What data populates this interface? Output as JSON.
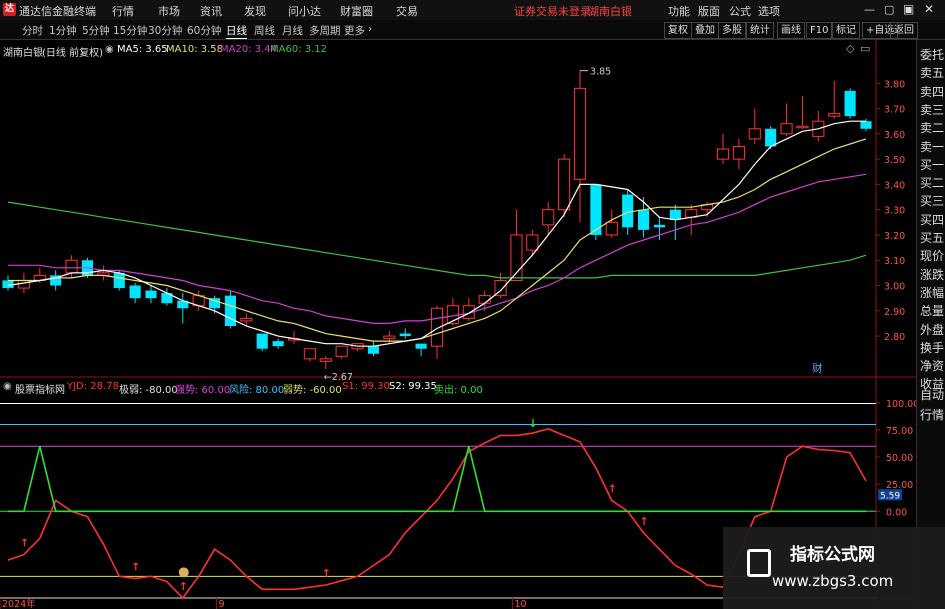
{
  "app": {
    "title": "通达信金融终端"
  },
  "menu": [
    "行情",
    "市场",
    "资讯",
    "发现",
    "问小达",
    "财富圈",
    "交易"
  ],
  "menu_notice": "证券交易未登录",
  "menu_stock": "湖南白银",
  "menu_right": [
    "功能",
    "版面",
    "公式",
    "选项"
  ],
  "tabs": [
    "分时",
    "1分钟",
    "5分钟",
    "15分钟",
    "30分钟",
    "60分钟",
    "日线",
    "周线",
    "月线",
    "多周期",
    "更多"
  ],
  "tab_active": "日线",
  "right_buttons": [
    "复权",
    "叠加",
    "多股",
    "统计",
    "画线",
    "F10",
    "标记",
    "+自选",
    "返回"
  ],
  "info": {
    "stock_name": "湖南白银",
    "mode": "(日线 前复权)",
    "ma5": "MA5: 3.65",
    "ma10": "MA10: 3.58",
    "ma20": "MA20: 3.44",
    "ma60": "MA60: 3.12"
  },
  "side_panel": [
    "委托",
    "卖五",
    "卖四",
    "卖三",
    "卖二",
    "卖一",
    "买一",
    "买二",
    "买三",
    "买四",
    "买五",
    "现价",
    "涨跌",
    "涨幅",
    "总量",
    "外盘",
    "换手",
    "净资",
    "收益",
    "自动",
    "行情"
  ],
  "indicator_header": {
    "name": "股票指标网",
    "items": [
      {
        "text": "YJD: 28.78",
        "color": "#ff3030"
      },
      {
        "text": "极弱: -80.00",
        "color": "#e0e0e0"
      },
      {
        "text": "强势: 60.00",
        "color": "#e040e0"
      },
      {
        "text": "风险: 80.00",
        "color": "#40c0ff"
      },
      {
        "text": "弱势: -60.00",
        "color": "#e0e060"
      },
      {
        "text": "S1: 99.30",
        "color": "#ff3030"
      },
      {
        "text": "S2: 99.35",
        "color": "#ffffff"
      },
      {
        "text": "卖出: 0.00",
        "color": "#30e030"
      }
    ]
  },
  "colors": {
    "up": "#ff3232",
    "down": "#00e5ff",
    "ma5": "#ffffff",
    "ma10": "#e8e070",
    "ma20": "#d040d0",
    "ma60": "#40c040"
  },
  "watermark": {
    "title": "指标公式网",
    "url": "www.zbgs3.com"
  },
  "chart_data": [
    {
      "type": "candlestick",
      "ylim": [
        2.65,
        3.9
      ],
      "yticks": [
        2.8,
        2.9,
        3.0,
        3.1,
        3.2,
        3.3,
        3.4,
        3.5,
        3.6,
        3.7,
        3.8
      ],
      "ma_legend": [
        "MA5",
        "MA10",
        "MA20",
        "MA60"
      ],
      "high_label": "3.85",
      "low_label": "2.67",
      "fin_marker": "财",
      "candles": [
        [
          3.02,
          2.99,
          3.04,
          2.98
        ],
        [
          2.99,
          3.02,
          3.05,
          2.97
        ],
        [
          3.02,
          3.04,
          3.07,
          3.01
        ],
        [
          3.04,
          3.0,
          3.06,
          2.98
        ],
        [
          3.05,
          3.1,
          3.12,
          3.03
        ],
        [
          3.1,
          3.04,
          3.11,
          3.03
        ],
        [
          3.04,
          3.05,
          3.08,
          3.02
        ],
        [
          3.05,
          2.99,
          3.06,
          2.98
        ],
        [
          3.0,
          2.95,
          3.01,
          2.93
        ],
        [
          2.98,
          2.95,
          3.0,
          2.93
        ],
        [
          2.97,
          2.93,
          2.99,
          2.92
        ],
        [
          2.94,
          2.91,
          2.97,
          2.85
        ],
        [
          2.92,
          2.96,
          2.98,
          2.9
        ],
        [
          2.95,
          2.91,
          2.96,
          2.89
        ],
        [
          2.96,
          2.84,
          2.98,
          2.83
        ],
        [
          2.86,
          2.87,
          2.89,
          2.84
        ],
        [
          2.81,
          2.75,
          2.81,
          2.74
        ],
        [
          2.78,
          2.76,
          2.79,
          2.75
        ],
        [
          2.79,
          2.79,
          2.82,
          2.77
        ],
        [
          2.71,
          2.75,
          2.75,
          2.7
        ],
        [
          2.7,
          2.71,
          2.72,
          2.67
        ],
        [
          2.72,
          2.76,
          2.76,
          2.71
        ],
        [
          2.75,
          2.77,
          2.77,
          2.74
        ],
        [
          2.76,
          2.73,
          2.78,
          2.72
        ],
        [
          2.79,
          2.8,
          2.82,
          2.77
        ],
        [
          2.81,
          2.8,
          2.83,
          2.79
        ],
        [
          2.77,
          2.75,
          2.77,
          2.72
        ],
        [
          2.76,
          2.91,
          2.92,
          2.71
        ],
        [
          2.85,
          2.92,
          2.95,
          2.84
        ],
        [
          2.87,
          2.92,
          2.95,
          2.86
        ],
        [
          2.93,
          2.96,
          2.98,
          2.9
        ],
        [
          2.96,
          3.02,
          3.05,
          2.95
        ],
        [
          3.02,
          3.2,
          3.3,
          3.02
        ],
        [
          3.14,
          3.2,
          3.22,
          3.12
        ],
        [
          3.24,
          3.3,
          3.33,
          3.2
        ],
        [
          3.3,
          3.5,
          3.52,
          3.27
        ],
        [
          3.42,
          3.78,
          3.85,
          3.25
        ],
        [
          3.4,
          3.2,
          3.4,
          3.18
        ],
        [
          3.2,
          3.25,
          3.3,
          3.19
        ],
        [
          3.36,
          3.23,
          3.38,
          3.2
        ],
        [
          3.3,
          3.22,
          3.35,
          3.19
        ],
        [
          3.24,
          3.23,
          3.27,
          3.18
        ],
        [
          3.3,
          3.26,
          3.32,
          3.18
        ],
        [
          3.27,
          3.3,
          3.32,
          3.2
        ],
        [
          3.3,
          3.32,
          3.33,
          3.27
        ],
        [
          3.5,
          3.54,
          3.6,
          3.48
        ],
        [
          3.5,
          3.55,
          3.58,
          3.46
        ],
        [
          3.58,
          3.62,
          3.7,
          3.56
        ],
        [
          3.62,
          3.55,
          3.63,
          3.54
        ],
        [
          3.6,
          3.64,
          3.72,
          3.59
        ],
        [
          3.63,
          3.63,
          3.75,
          3.62
        ],
        [
          3.59,
          3.65,
          3.69,
          3.57
        ],
        [
          3.67,
          3.68,
          3.81,
          3.66
        ],
        [
          3.77,
          3.67,
          3.78,
          3.66
        ],
        [
          3.65,
          3.62,
          3.66,
          3.61
        ]
      ],
      "ma5": [
        3.0,
        3.01,
        3.02,
        3.03,
        3.05,
        3.05,
        3.06,
        3.05,
        3.03,
        3.0,
        2.97,
        2.94,
        2.92,
        2.9,
        2.87,
        2.84,
        2.82,
        2.8,
        2.79,
        2.78,
        2.77,
        2.77,
        2.76,
        2.76,
        2.77,
        2.78,
        2.79,
        2.83,
        2.86,
        2.89,
        2.93,
        2.98,
        3.05,
        3.12,
        3.2,
        3.28,
        3.4,
        3.4,
        3.39,
        3.38,
        3.33,
        3.27,
        3.26,
        3.27,
        3.28,
        3.34,
        3.4,
        3.48,
        3.55,
        3.58,
        3.61,
        3.62,
        3.64,
        3.65,
        3.65
      ],
      "ma10": [
        3.02,
        3.02,
        3.02,
        3.03,
        3.03,
        3.04,
        3.04,
        3.03,
        3.02,
        3.01,
        3.0,
        2.98,
        2.96,
        2.94,
        2.92,
        2.9,
        2.88,
        2.86,
        2.85,
        2.83,
        2.81,
        2.8,
        2.79,
        2.78,
        2.78,
        2.78,
        2.79,
        2.81,
        2.83,
        2.85,
        2.87,
        2.9,
        2.95,
        3.0,
        3.05,
        3.1,
        3.18,
        3.22,
        3.26,
        3.29,
        3.3,
        3.31,
        3.31,
        3.31,
        3.32,
        3.33,
        3.35,
        3.38,
        3.42,
        3.45,
        3.48,
        3.51,
        3.54,
        3.56,
        3.58
      ],
      "ma20": [
        3.08,
        3.08,
        3.08,
        3.07,
        3.07,
        3.07,
        3.06,
        3.06,
        3.05,
        3.04,
        3.03,
        3.02,
        3.0,
        2.99,
        2.98,
        2.96,
        2.94,
        2.93,
        2.91,
        2.9,
        2.88,
        2.87,
        2.86,
        2.85,
        2.85,
        2.86,
        2.86,
        2.87,
        2.88,
        2.89,
        2.91,
        2.93,
        2.95,
        2.98,
        3.0,
        3.03,
        3.07,
        3.1,
        3.13,
        3.16,
        3.18,
        3.2,
        3.22,
        3.24,
        3.25,
        3.27,
        3.29,
        3.32,
        3.35,
        3.37,
        3.39,
        3.41,
        3.42,
        3.43,
        3.44
      ],
      "ma60": [
        3.33,
        3.32,
        3.31,
        3.3,
        3.29,
        3.28,
        3.27,
        3.26,
        3.25,
        3.24,
        3.23,
        3.22,
        3.21,
        3.2,
        3.19,
        3.18,
        3.17,
        3.16,
        3.15,
        3.14,
        3.13,
        3.12,
        3.11,
        3.1,
        3.09,
        3.08,
        3.07,
        3.06,
        3.05,
        3.04,
        3.04,
        3.03,
        3.03,
        3.03,
        3.03,
        3.03,
        3.03,
        3.03,
        3.04,
        3.04,
        3.04,
        3.04,
        3.04,
        3.04,
        3.04,
        3.04,
        3.04,
        3.04,
        3.05,
        3.06,
        3.07,
        3.08,
        3.09,
        3.1,
        3.12
      ]
    },
    {
      "type": "line",
      "ylim": [
        -80,
        110
      ],
      "yticks": [
        100.0,
        75.0,
        50.0,
        25.0,
        0.0
      ],
      "current_label": "5.59",
      "x_labels": [
        "2024年",
        "9",
        "10"
      ],
      "h_lines": [
        {
          "name": "S2",
          "value": 99.35,
          "color": "#ffffff"
        },
        {
          "name": "风险",
          "value": 80,
          "color": "#40c0ff"
        },
        {
          "name": "强势",
          "value": 60,
          "color": "#e040e0"
        },
        {
          "name": "卖出",
          "value": 0,
          "color": "#30e030"
        },
        {
          "name": "弱势",
          "value": -60,
          "color": "#e0e060"
        },
        {
          "name": "极弱",
          "value": -80,
          "color": "#e0e0e0"
        }
      ],
      "series": [
        {
          "name": "YJD",
          "color": "#ff3030",
          "values": [
            -45,
            -40,
            -25,
            10,
            0,
            -5,
            -30,
            -60,
            -62,
            -60,
            -65,
            -80,
            -60,
            -35,
            -45,
            -60,
            -72,
            -72,
            -72,
            -70,
            -68,
            -64,
            -60,
            -50,
            -40,
            -20,
            -5,
            10,
            30,
            55,
            63,
            70,
            70,
            72,
            76,
            70,
            64,
            40,
            10,
            0,
            -20,
            -35,
            -50,
            -58,
            -68,
            -70,
            -40,
            -5,
            0,
            50,
            60,
            57,
            56,
            54,
            28
          ]
        },
        {
          "name": "卖出",
          "color": "#30e030",
          "values": [
            0,
            0,
            60,
            0,
            0,
            0,
            0,
            0,
            0,
            0,
            0,
            0,
            0,
            0,
            0,
            0,
            0,
            0,
            0,
            0,
            0,
            0,
            0,
            0,
            0,
            0,
            0,
            0,
            0,
            60,
            0,
            0,
            0,
            0,
            0,
            0,
            0,
            0,
            0,
            0,
            0,
            0,
            0,
            0,
            0,
            0,
            0,
            0,
            0,
            0,
            0,
            0,
            0,
            0,
            0
          ]
        }
      ]
    }
  ]
}
